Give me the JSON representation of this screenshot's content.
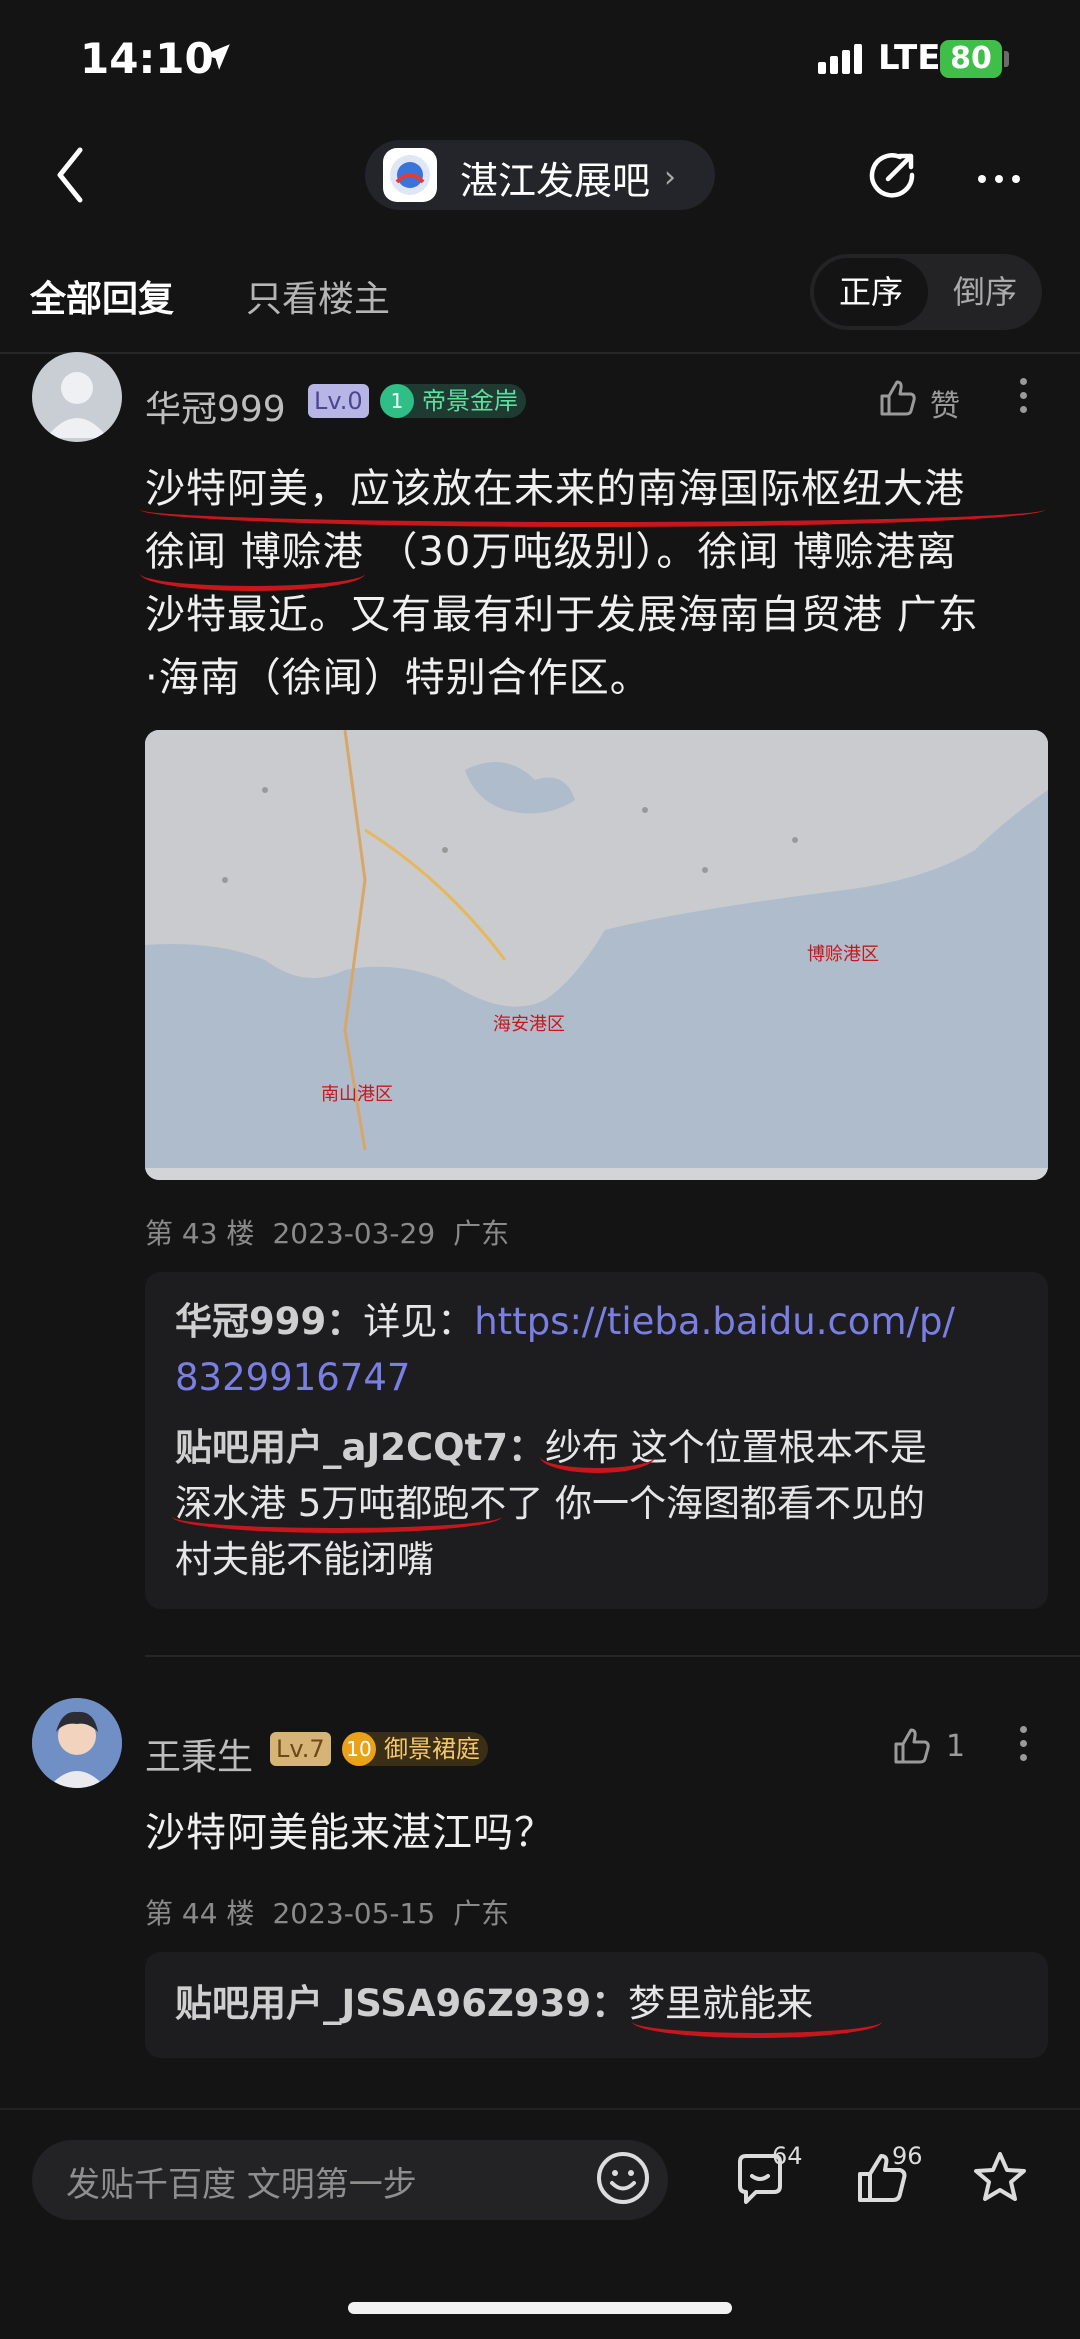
{
  "status_bar": {
    "time": "14:10",
    "network": "LTE",
    "battery": "80"
  },
  "nav": {
    "forum_name": "湛江发展吧",
    "chevron": "›"
  },
  "tabs": {
    "all": "全部回复",
    "owner_only": "只看楼主",
    "sort_asc": "正序",
    "sort_desc": "倒序"
  },
  "post43": {
    "username": "华冠999",
    "level": "Lv.0",
    "badge_num": "1",
    "badge_text": "帝景金岸",
    "like_label": "赞",
    "content_lines": [
      "沙特阿美，应该放在未来的南海国际枢纽大港",
      "徐闻 博赊港 （30万吨级别）。徐闻 博赊港离",
      "沙特最近。又有最有利于发展海南自贸港 广东",
      "·海南（徐闻）特别合作区。"
    ],
    "floor": "第 43 楼",
    "date": "2023-03-29",
    "region": "广东",
    "replies": {
      "r1_user": "华冠999：",
      "r1_text": "详见：",
      "r1_link_1": "https://tieba.baidu.com/p/",
      "r1_link_2": "8329916747",
      "r2_user": "贴吧用户_aJ2CQt7：",
      "r2_text_1": "纱布 这个位置根本不是",
      "r2_text_2": "深水港 5万吨都跑不了 你一个海图都看不见的",
      "r2_text_3": "村夫能不能闭嘴"
    },
    "map": {
      "label_boshe": "博赊港区",
      "label_haian": "海安港区",
      "label_nanshan": "南山港区"
    }
  },
  "post44": {
    "username": "王秉生",
    "level": "Lv.7",
    "badge_num": "10",
    "badge_text": "御景裙庭",
    "like_count": "1",
    "content": "沙特阿美能来湛江吗？",
    "floor": "第 44 楼",
    "date": "2023-05-15",
    "region": "广东",
    "reply_user": "贴吧用户_JSSA96Z939：",
    "reply_text": "梦里就能来"
  },
  "bottom": {
    "placeholder": "发贴千百度 文明第一步",
    "comment_count": "64",
    "like_count": "96"
  },
  "colors": {
    "accent_link": "#7a7fe3",
    "underline_red": "#c8161d",
    "badge_green": "#3fbf4a"
  }
}
